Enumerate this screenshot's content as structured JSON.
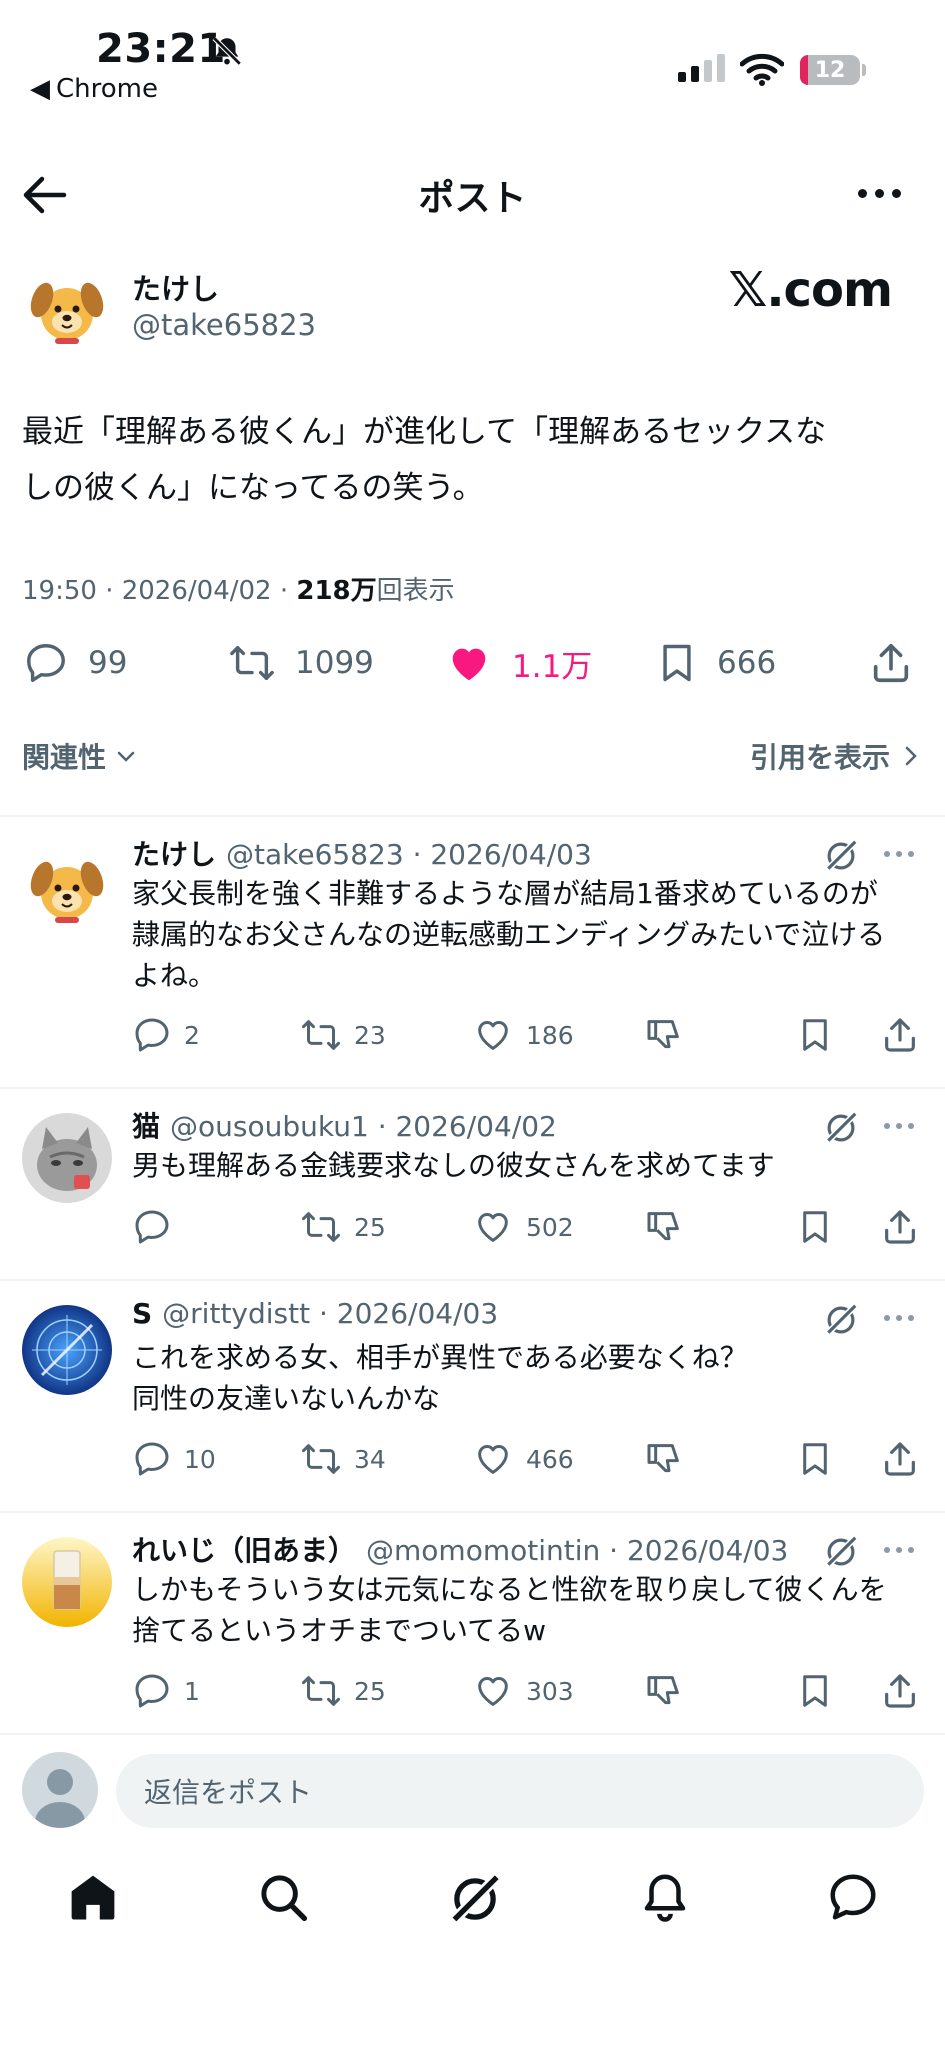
{
  "status_bar": {
    "time": "23:21",
    "back_app": "Chrome",
    "battery": "12"
  },
  "header": {
    "title": "ポスト"
  },
  "post": {
    "author_name": "たけし",
    "author_handle": "@take65823",
    "brand": "𝕏.com",
    "text_line1": "最近「理解ある彼くん」が進化して「理解あるセックスな",
    "text_line2": "しの彼くん」になってるの笑う。",
    "meta_time": "19:50 · 2026/04/02 · ",
    "meta_views": "218万",
    "meta_views_suffix": "回表示",
    "replies": "99",
    "reposts": "1099",
    "likes": "1.1万",
    "bookmarks": "666"
  },
  "filter": {
    "sort_label": "関連性",
    "quotes_label": "引用を表示"
  },
  "replies": [
    {
      "name": "たけし",
      "handle_date": "@take65823 · 2026/04/03",
      "lines": [
        "家父長制を強く非難するような層が結局1番求めているのが",
        "隷属的なお父さんなの逆転感動エンディングみたいで泣ける",
        "よね。"
      ],
      "replies": "2",
      "reposts": "23",
      "likes": "186"
    },
    {
      "name": "猫",
      "handle_date": "@ousoubuku1 · 2026/04/02",
      "lines": [
        "男も理解ある金銭要求なしの彼女さんを求めてます"
      ],
      "replies": "",
      "reposts": "25",
      "likes": "502"
    },
    {
      "name": "S",
      "handle_date": "@rittydistt · 2026/04/03",
      "lines": [
        "これを求める女、相手が異性である必要なくね？",
        "同性の友達いないんかな"
      ],
      "replies": "10",
      "reposts": "34",
      "likes": "466"
    },
    {
      "name": "れいじ（旧あま）",
      "handle_date": "@momomotintin · 2026/04/03",
      "lines": [
        "しかもそういう女は元気になると性欲を取り戻して彼くんを",
        "捨てるというオチまでついてるw"
      ],
      "replies": "1",
      "reposts": "25",
      "likes": "303"
    }
  ],
  "composer": {
    "placeholder": "返信をポスト"
  },
  "icons": {
    "tabbar": [
      "home-icon",
      "search-icon",
      "grok-icon",
      "notifications-icon",
      "messages-icon"
    ]
  },
  "colors": {
    "like": "#f91880",
    "secondary_text": "#536471",
    "divider": "#eff3f4"
  }
}
